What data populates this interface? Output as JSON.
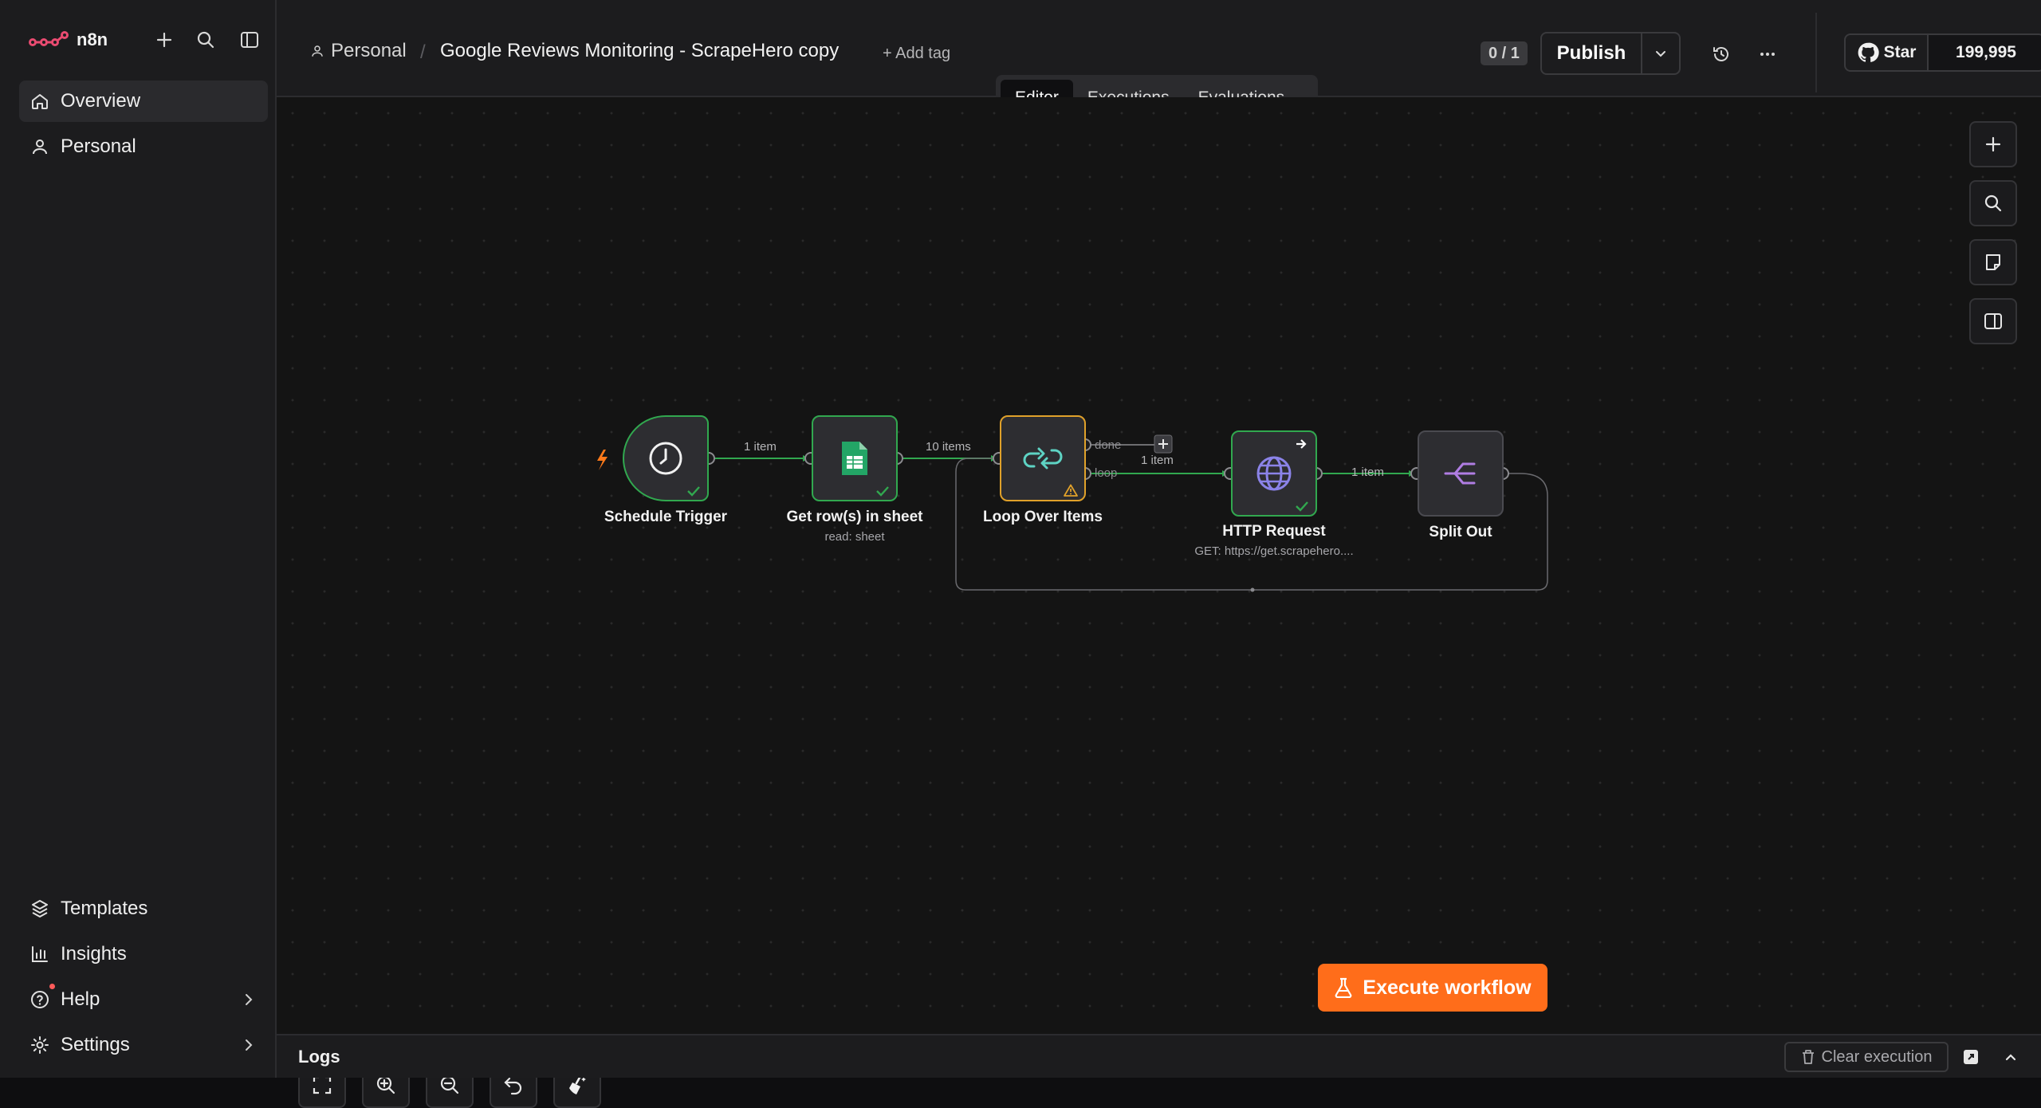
{
  "app": {
    "logo_text": "n8n"
  },
  "sidebar": {
    "items": [
      {
        "label": "Overview"
      },
      {
        "label": "Personal"
      }
    ],
    "bottom_items": [
      {
        "label": "Templates"
      },
      {
        "label": "Insights"
      },
      {
        "label": "Help"
      },
      {
        "label": "Settings"
      }
    ]
  },
  "header": {
    "project": "Personal",
    "separator": "/",
    "workflow_title": "Google Reviews Monitoring - ScrapeHero copy",
    "add_tag": "+ Add tag",
    "counter": "0 / 1",
    "publish_label": "Publish",
    "github_star_label": "Star",
    "github_star_count": "199,995"
  },
  "tabs": [
    {
      "label": "Editor",
      "active": true
    },
    {
      "label": "Executions",
      "active": false
    },
    {
      "label": "Evaluations",
      "active": false
    }
  ],
  "workflow": {
    "nodes": [
      {
        "name": "Schedule Trigger",
        "subtitle": "",
        "icon": "clock-icon",
        "status": "success"
      },
      {
        "name": "Get row(s) in sheet",
        "subtitle": "read: sheet",
        "icon": "google-sheets-icon",
        "status": "success"
      },
      {
        "name": "Loop Over Items",
        "subtitle": "",
        "icon": "loop-icon",
        "status": "warning"
      },
      {
        "name": "HTTP Request",
        "subtitle": "GET: https://get.scrapehero....",
        "icon": "globe-icon",
        "status": "success"
      },
      {
        "name": "Split Out",
        "subtitle": "",
        "icon": "split-out-icon",
        "status": "none"
      }
    ],
    "edge_labels": {
      "trigger_to_sheet": "1 item",
      "sheet_to_loop": "10 items",
      "loop_to_http": "1 item",
      "http_to_split": "1 item"
    },
    "loop_outputs": {
      "done": "done",
      "loop": "loop"
    }
  },
  "execute_button": {
    "label": "Execute workflow"
  },
  "logs": {
    "title": "Logs",
    "clear_label": "Clear execution"
  },
  "colors": {
    "accent": "#ff6d1a",
    "success": "#31a84f",
    "warning": "#e0a12a",
    "logo": "#ea4b71",
    "sheets": "#23a566",
    "loop": "#5ed3c4",
    "http": "#8b83e8",
    "split": "#b07de3"
  }
}
